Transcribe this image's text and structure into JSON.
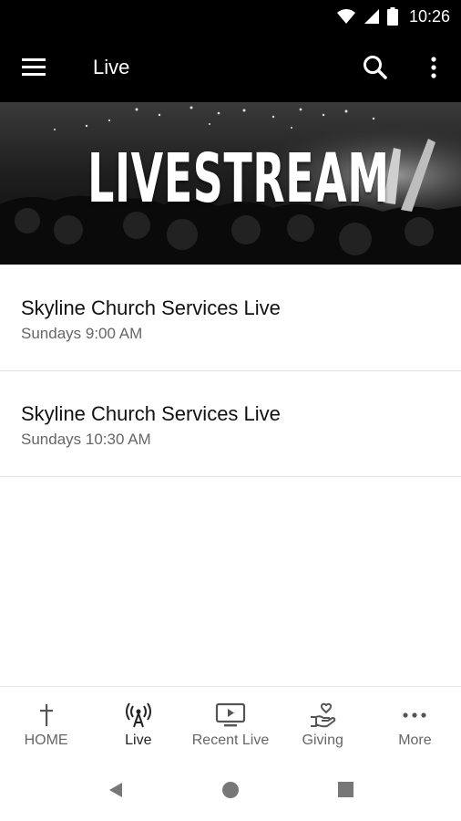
{
  "status_bar": {
    "time": "10:26"
  },
  "app_bar": {
    "title": "Live"
  },
  "hero": {
    "title": "LIVESTREAM"
  },
  "services": [
    {
      "title": "Skyline Church Services Live",
      "time": "Sundays 9:00 AM"
    },
    {
      "title": "Skyline Church Services Live",
      "time": "Sundays 10:30 AM"
    }
  ],
  "bottom_nav": [
    {
      "label": "HOME",
      "icon": "cross-icon"
    },
    {
      "label": "Live",
      "icon": "broadcast-icon",
      "active": true
    },
    {
      "label": "Recent Live",
      "icon": "tv-play-icon"
    },
    {
      "label": "Giving",
      "icon": "hand-heart-icon"
    },
    {
      "label": "More",
      "icon": "more-dots-icon"
    }
  ],
  "colors": {
    "app_bar": "#000000",
    "background": "#ffffff",
    "divider": "#e0e0e0",
    "text_primary": "#111111",
    "text_secondary": "#666666"
  }
}
